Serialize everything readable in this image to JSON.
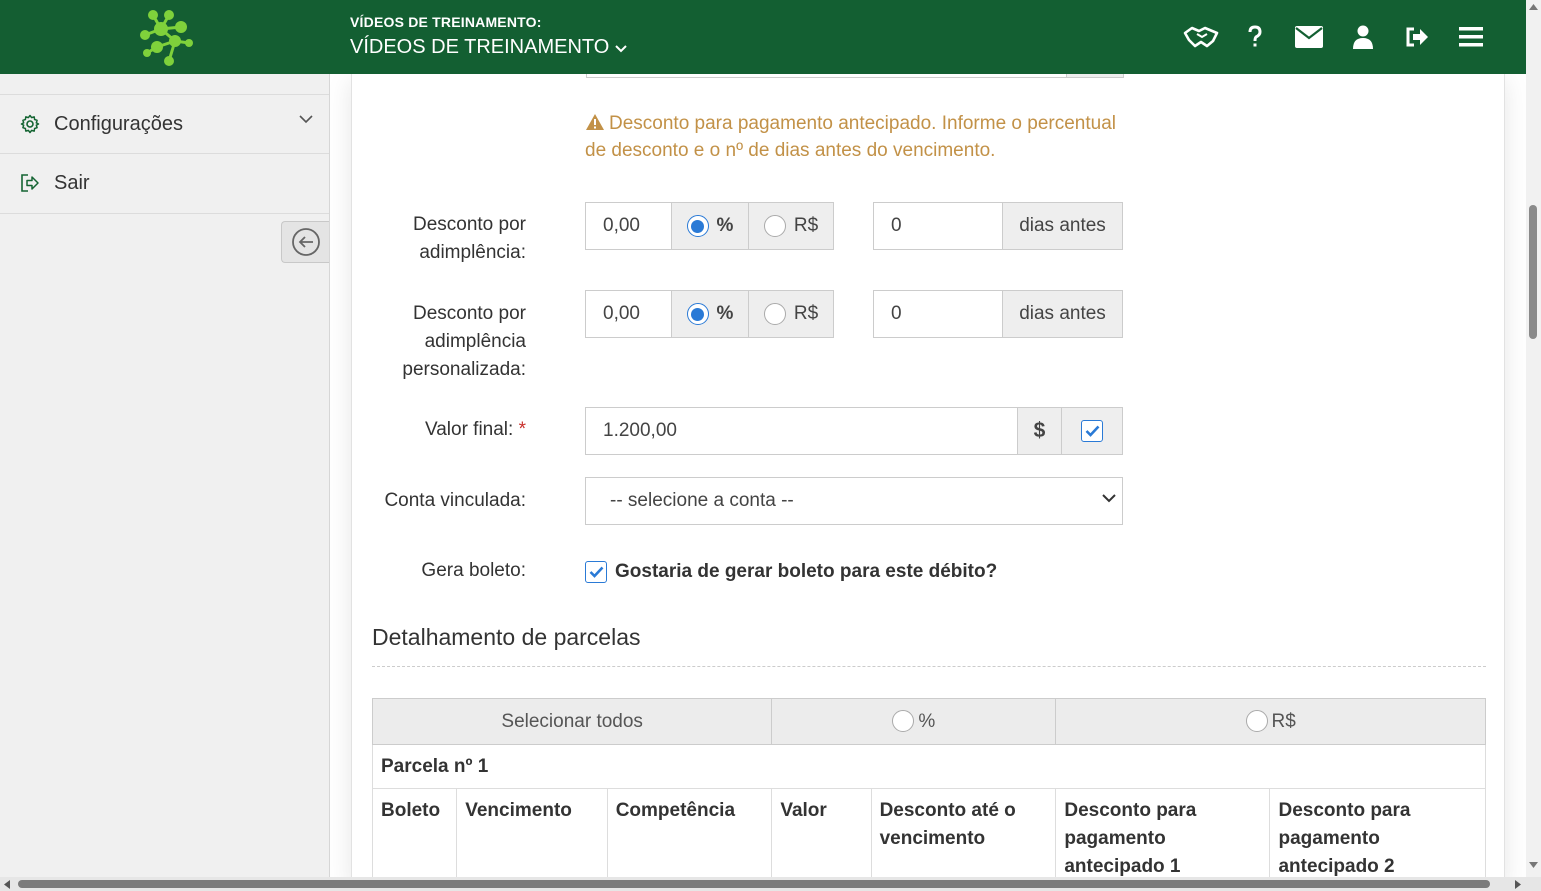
{
  "header": {
    "subtitle": "VÍDEOS DE TREINAMENTO:",
    "title": "VÍDEOS DE TREINAMENTO",
    "icons": [
      "handshake-icon",
      "help-icon",
      "mail-icon",
      "user-icon",
      "logout-icon",
      "menu-icon"
    ],
    "accent": "#135f32"
  },
  "sidebar": {
    "items": [
      {
        "label": "Configurações",
        "icon": "gear-icon"
      },
      {
        "label": "Sair",
        "icon": "exit-icon"
      }
    ]
  },
  "form": {
    "warning": "Desconto para pagamento antecipado. Informe o percentual de desconto e o nº de dias antes do vencimento.",
    "desconto1": {
      "label": "Desconto por adimplência:",
      "value": "0,00",
      "opt_pct": "%",
      "opt_brl": "R$",
      "selected": "%",
      "days": "0",
      "days_suffix": "dias antes"
    },
    "desconto2": {
      "label": "Desconto por adimplência personalizada:",
      "value": "0,00",
      "opt_pct": "%",
      "opt_brl": "R$",
      "selected": "%",
      "days": "0",
      "days_suffix": "dias antes"
    },
    "valor_final": {
      "label": "Valor final:",
      "required_mark": "*",
      "value": "1.200,00",
      "currency_symbol": "$",
      "checked": true
    },
    "conta": {
      "label": "Conta vinculada:",
      "selected": "-- selecione a conta --"
    },
    "boleto": {
      "label": "Gera boleto:",
      "question": "Gostaria de gerar boleto para este débito?",
      "checked": true
    }
  },
  "parcelas": {
    "title": "Detalhamento de parcelas",
    "select_all": "Selecionar todos",
    "opt_pct": "%",
    "opt_brl": "R$",
    "parcela_label": "Parcela nº 1",
    "columns": [
      "Boleto",
      "Vencimento",
      "Competência",
      "Valor",
      "Desconto até o vencimento",
      "Desconto para pagamento antecipado 1",
      "Desconto para pagamento antecipado 2"
    ]
  }
}
